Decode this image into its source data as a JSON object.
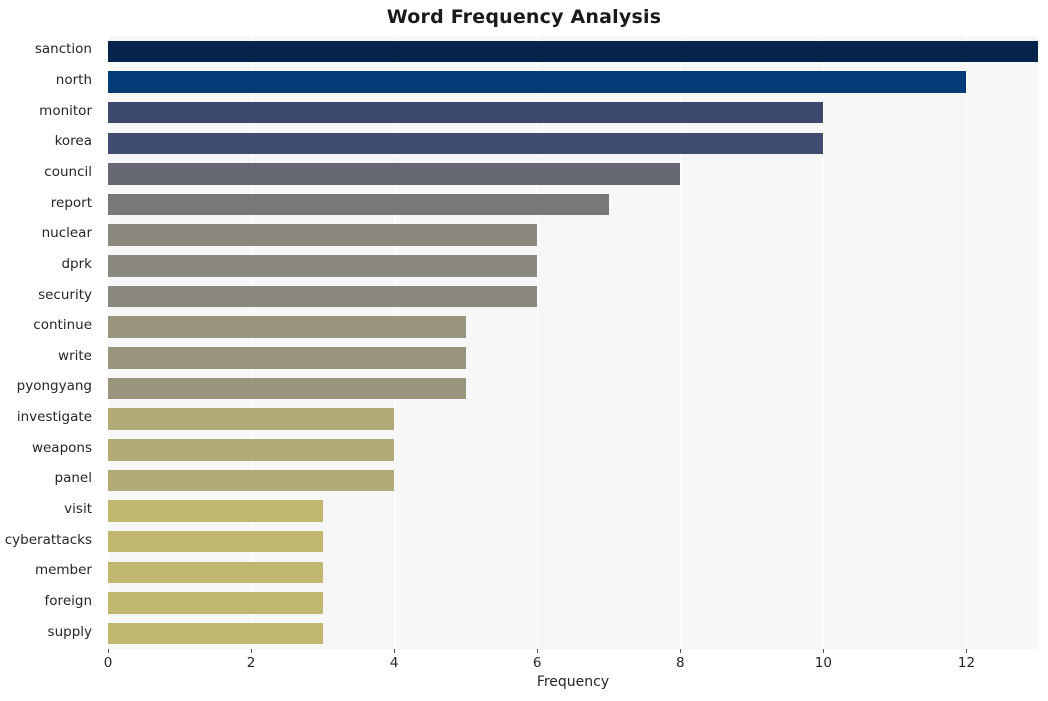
{
  "chart_data": {
    "type": "bar",
    "orientation": "horizontal",
    "title": "Word Frequency Analysis",
    "xlabel": "Frequency",
    "ylabel": "",
    "xlim": [
      0,
      13
    ],
    "xticks": [
      0,
      2,
      4,
      6,
      8,
      10,
      12
    ],
    "xtick_labels": [
      "0",
      "2",
      "4",
      "6",
      "8",
      "10",
      "12"
    ],
    "grid": true,
    "legend": false,
    "categories": [
      "sanction",
      "north",
      "monitor",
      "korea",
      "council",
      "report",
      "nuclear",
      "dprk",
      "security",
      "continue",
      "write",
      "pyongyang",
      "investigate",
      "weapons",
      "panel",
      "visit",
      "cyberattacks",
      "member",
      "foreign",
      "supply"
    ],
    "values": [
      13,
      12,
      10,
      10,
      8,
      7,
      6,
      6,
      6,
      5,
      5,
      5,
      4,
      4,
      4,
      3,
      3,
      3,
      3,
      3
    ],
    "bar_colors": [
      "#06244b",
      "#033b77",
      "#3c486e",
      "#414c71",
      "#656873",
      "#77787a",
      "#8b887f",
      "#8b887f",
      "#8b887f",
      "#9a967e",
      "#9a967e",
      "#9a967e",
      "#b3ab77",
      "#b3ab77",
      "#b3ab77",
      "#c2b770",
      "#c2b770",
      "#c2b770",
      "#c2b770",
      "#c2b770"
    ],
    "plot_background": "#f7f7f7",
    "grid_color": "#ffffff",
    "figure_background": "#ffffff"
  }
}
